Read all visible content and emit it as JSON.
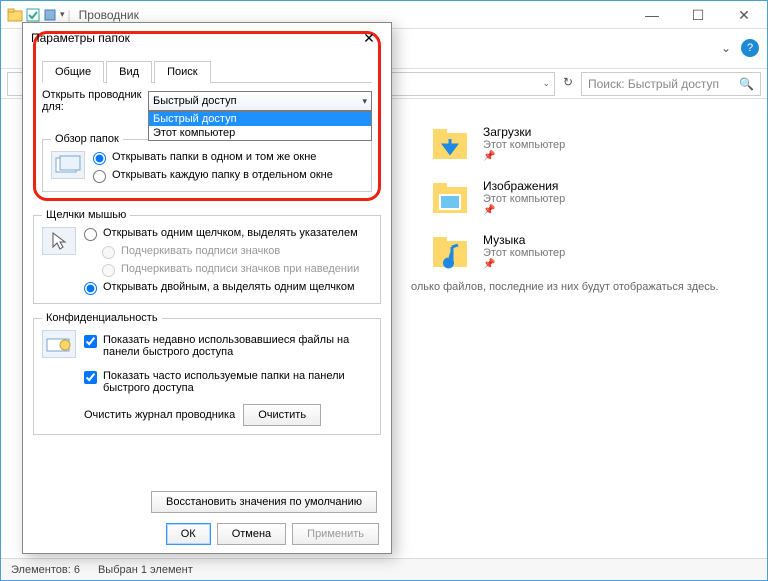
{
  "window": {
    "title": "Проводник",
    "min": "—",
    "max": "☐",
    "close": "✕"
  },
  "help": "?",
  "search": {
    "placeholder": "Поиск: Быстрый доступ"
  },
  "items": [
    {
      "name": "Загрузки",
      "sub": "Этот компьютер"
    },
    {
      "name": "Изображения",
      "sub": "Этот компьютер"
    },
    {
      "name": "Музыка",
      "sub": "Этот компьютер"
    }
  ],
  "content_hint": "олько файлов, последние из них будут отображаться здесь.",
  "status": {
    "left": "Элементов: 6",
    "sel": "Выбран 1 элемент"
  },
  "dialog": {
    "title": "Параметры папок",
    "tabs": {
      "general": "Общие",
      "view": "Вид",
      "search": "Поиск"
    },
    "open_label": "Открыть проводник для:",
    "combo_value": "Быстрый доступ",
    "combo_opts": [
      "Быстрый доступ",
      "Этот компьютер"
    ],
    "browse": {
      "legend": "Обзор папок",
      "r1": "Открывать папки в одном и том же окне",
      "r2": "Открывать каждую папку в отдельном окне"
    },
    "click": {
      "legend": "Щелчки мышью",
      "r1": "Открывать одним щелчком, выделять указателем",
      "r1a": "Подчеркивать подписи значков",
      "r1b": "Подчеркивать подписи значков при наведении",
      "r2": "Открывать двойным, а выделять одним щелчком"
    },
    "priv": {
      "legend": "Конфиденциальность",
      "c1": "Показать недавно использовавшиеся файлы на панели быстрого доступа",
      "c2": "Показать часто используемые папки на панели быстрого доступа",
      "clear_lbl": "Очистить журнал проводника",
      "clear_btn": "Очистить"
    },
    "restore": "Восстановить значения по умолчанию",
    "ok": "ОК",
    "cancel": "Отмена",
    "apply": "Применить"
  }
}
